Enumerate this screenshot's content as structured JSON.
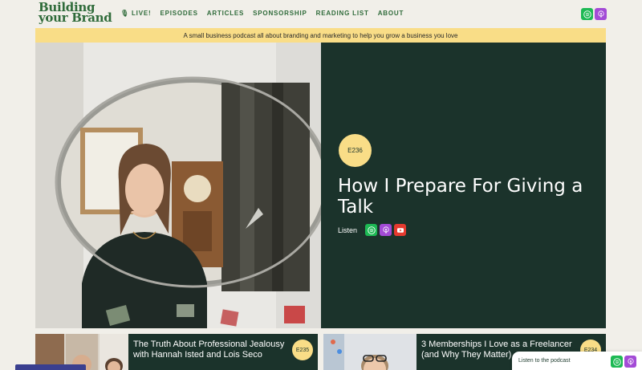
{
  "logo": {
    "line1": "Building",
    "line2": "your Brand"
  },
  "nav": [
    {
      "label": "🎙 LIVE!"
    },
    {
      "label": "EPISODES"
    },
    {
      "label": "ARTICLES"
    },
    {
      "label": "SPONSORSHIP"
    },
    {
      "label": "READING LIST"
    },
    {
      "label": "ABOUT"
    }
  ],
  "banner": "A small business podcast all about branding and marketing to help you grow a business you love",
  "hero": {
    "episode": "E236",
    "title": "How I Prepare For Giving a Talk",
    "listen_label": "Listen"
  },
  "cards": [
    {
      "title": "The Truth About Professional Jealousy with Hannah Isted and Lois Seco",
      "episode": "E235"
    },
    {
      "title": "3 Memberships I Love as a Freelancer (and Why They Matter)",
      "episode": "E234"
    }
  ],
  "listen_podcast": "Listen to the podcast",
  "colors": {
    "green_dark": "#1b332b",
    "brand_green": "#2f6b3a",
    "yellow": "#f9dd87",
    "spotify": "#1db954",
    "apple_podcasts": "#a34bd6",
    "youtube": "#e53a2f"
  },
  "icons": [
    "spotify-icon",
    "apple-podcasts-icon",
    "youtube-icon"
  ]
}
